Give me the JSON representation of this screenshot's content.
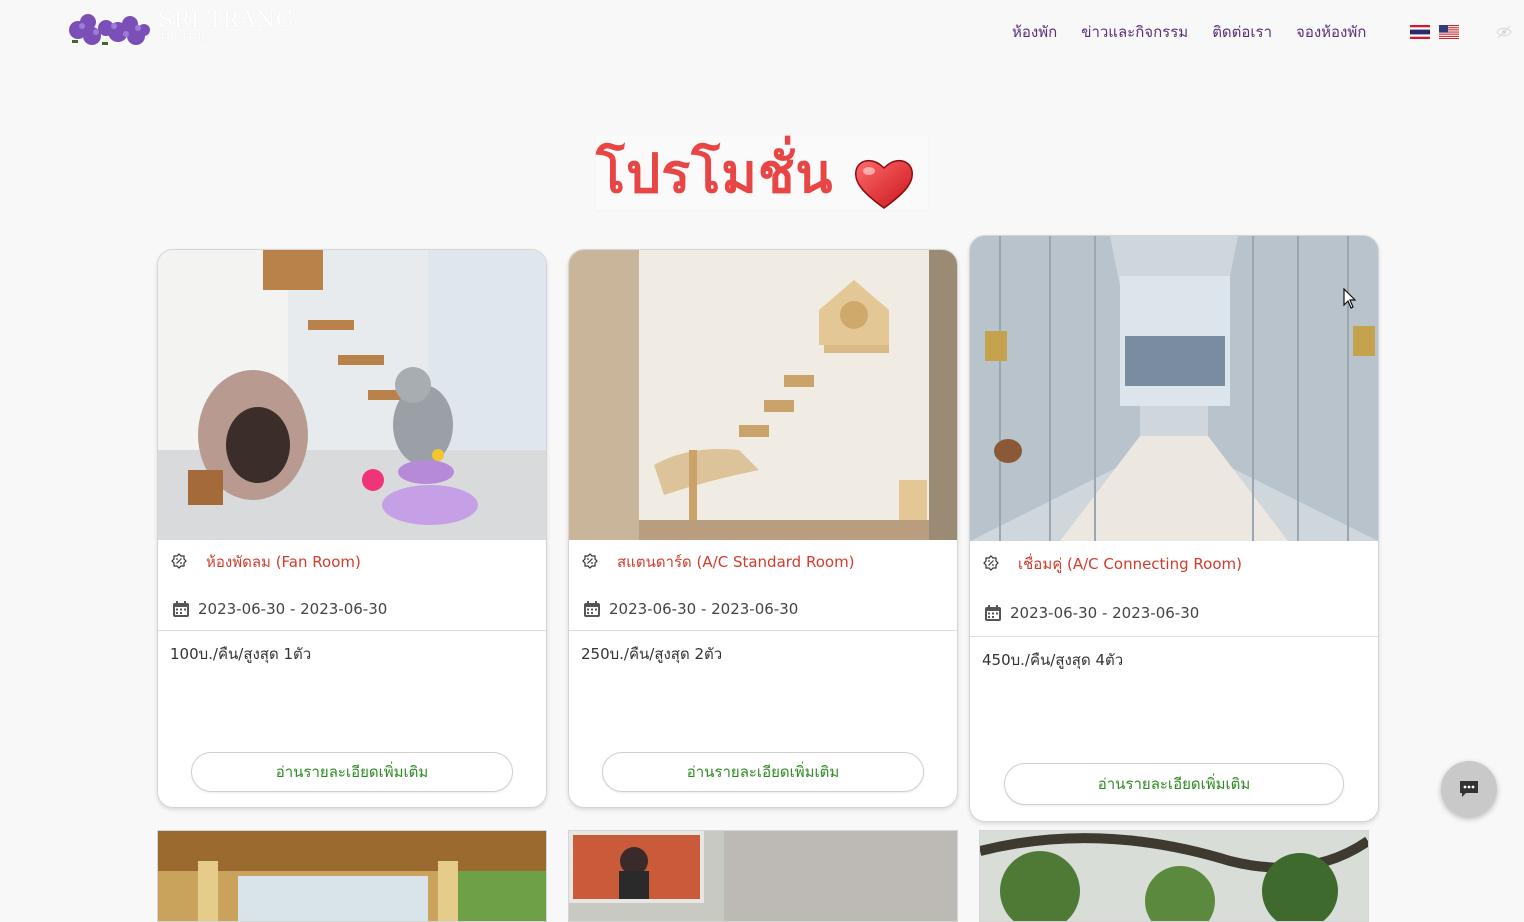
{
  "header": {
    "logo_name": "SRI TRANG",
    "logo_sub": "HOTEL",
    "nav": [
      "ห้องพัก",
      "ข่าวและกิจกรรม",
      "ติดต่อเรา",
      "จองห้องพัก"
    ],
    "flags": [
      "thai-flag-icon",
      "us-flag-icon"
    ]
  },
  "page_title": "โปรโมชั่น",
  "cards": [
    {
      "room": "ห้องพัดลม (Fan Room)",
      "date": "2023-06-30 - 2023-06-30",
      "price": "100บ./คืน/สูงสุด 1ตัว",
      "button": "อ่านรายละเอียดเพิ่มเติม"
    },
    {
      "room": "สแตนดาร์ด (A/C Standard Room)",
      "date": "2023-06-30 - 2023-06-30",
      "price": "250บ./คืน/สูงสุด 2ตัว",
      "button": "อ่านรายละเอียดเพิ่มเติม"
    },
    {
      "room": "เชื่อมคู่ (A/C Connecting Room)",
      "date": "2023-06-30 - 2023-06-30",
      "price": "450บ./คืน/สูงสุด 4ตัว",
      "button": "อ่านรายละเอียดเพิ่มเติม"
    }
  ],
  "colors": {
    "title": "#e84545",
    "room_name": "#d33b2c",
    "button_text": "#2e8b22",
    "nav": "#5a2f7a"
  }
}
